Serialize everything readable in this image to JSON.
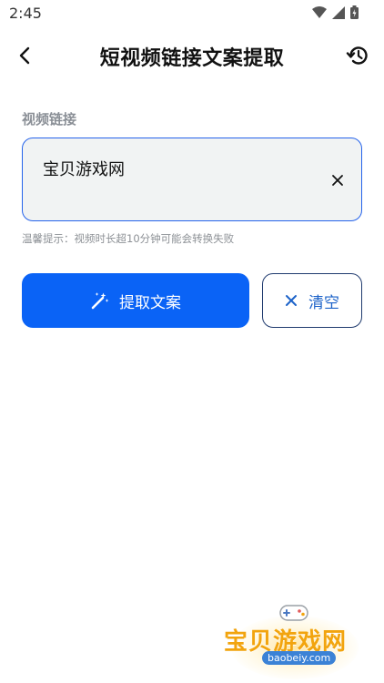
{
  "status_bar": {
    "time": "2:45",
    "icons": [
      "wifi-icon",
      "signal-icon",
      "battery-icon"
    ]
  },
  "header": {
    "title": "短视频链接文案提取",
    "back_icon": "back-arrow-icon",
    "history_icon": "history-icon"
  },
  "form": {
    "label": "视频链接",
    "input_value": "宝贝游戏网",
    "hint": "温馨提示：视频时长超10分钟可能会转换失败"
  },
  "buttons": {
    "extract_label": "提取文案",
    "clear_label": "清空"
  },
  "watermark": {
    "text": "宝贝游戏网",
    "url": "baobeiy.com"
  },
  "colors": {
    "primary": "#0a63f6",
    "input_border": "#2563eb",
    "input_bg": "#f1f3f3",
    "outline_border": "#1f3a6e",
    "watermark": "#f2a40e"
  }
}
